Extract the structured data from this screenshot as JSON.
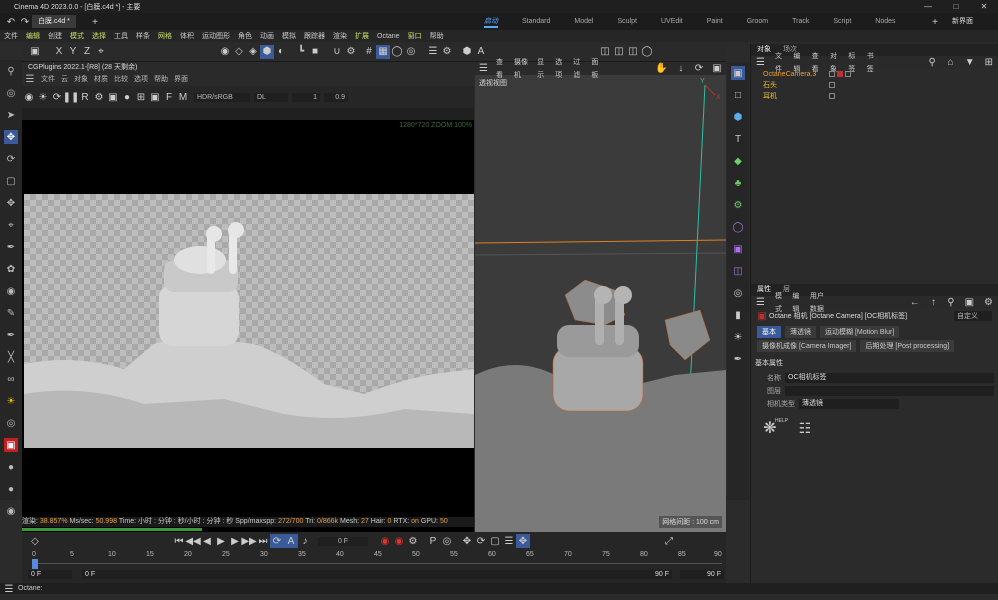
{
  "titlebar": {
    "title": "Cinema 4D 2023.0.0 - [白膜.c4d *] - 主要"
  },
  "tabs": {
    "doc": "白膜.c4d *",
    "layouts": [
      "启动",
      "Standard",
      "Model",
      "Sculpt",
      "UVEdit",
      "Paint",
      "Groom",
      "Track",
      "Script",
      "Nodes"
    ],
    "new_layout": "新界面"
  },
  "menu": [
    "文件",
    "编辑",
    "创建",
    "模式",
    "选择",
    "工具",
    "样条",
    "网格",
    "体积",
    "运动图形",
    "角色",
    "动画",
    "模拟",
    "跟踪器",
    "渲染",
    "扩展",
    "Octane",
    "窗口",
    "帮助"
  ],
  "axis": {
    "x": "X",
    "y": "Y",
    "z": "Z"
  },
  "render_view": {
    "title": "CGPlugins   2022.1-[R8] (28 天剩余)",
    "menu": [
      "文件",
      "云",
      "对象",
      "材质",
      "比较",
      "选项",
      "帮助",
      "界面"
    ],
    "colorspace": "HDR/sRGB",
    "mode": "DL",
    "value1": "1",
    "value2": "0.9",
    "zoom_overlay": "1280*720 ZOOM:100%",
    "stats": {
      "p1": "渲染:",
      "p2": "38.857%",
      "p3": "Ms/sec:",
      "p4": "50.998",
      "p5": "Time: 小时 : 分钟 : 秒/小时 : 分钟 : 秒",
      "p6": "Spp/maxspp:",
      "p7": "272/700",
      "p8": "Tri:",
      "p9": "0/866k",
      "p10": "Mesh:",
      "p11": "27",
      "p12": "Hair:",
      "p13": "0",
      "p14": "RTX:",
      "p15": "on",
      "p16": "GPU:",
      "p17": "50"
    }
  },
  "viewport": {
    "menu": [
      "查看",
      "摄像机",
      "显示",
      "选项",
      "过滤",
      "面板"
    ],
    "label": "透视视图",
    "grid_scale": "网格间距 : 100 cm",
    "axis_y": "Y",
    "axis_x": "X"
  },
  "objects": {
    "tabs": [
      "对象",
      "场次"
    ],
    "menu": [
      "文件",
      "编辑",
      "查看",
      "对象",
      "标签",
      "书签"
    ],
    "items": [
      "OctaneCamera.3",
      "石头",
      "耳机"
    ]
  },
  "attributes": {
    "tabs": [
      "属性",
      "层"
    ],
    "menu": [
      "模式",
      "编辑",
      "用户数据"
    ],
    "title": "Octane 相机 [Octane Camera] [OC相机标签]",
    "preset": "自定义",
    "buttons": [
      "基本",
      "薄透镜",
      "运动模糊 [Motion Blur]",
      "摄像机成像 [Camera Imager]",
      "后期处理 [Post processing]"
    ],
    "section": "基本属性",
    "name_label": "名称",
    "name_value": "OC相机标签",
    "layer_label": "图层",
    "camtype_label": "相机类型",
    "camtype_value": "薄透镜",
    "help": "HELP"
  },
  "timeline": {
    "current": "0 F",
    "ticks": [
      "0",
      "5",
      "10",
      "15",
      "20",
      "25",
      "30",
      "35",
      "40",
      "45",
      "50",
      "55",
      "60",
      "65",
      "70",
      "75",
      "80",
      "85",
      "90"
    ],
    "start": "0 F",
    "start2": "0 F",
    "end": "90 F",
    "end2": "90 F"
  },
  "status": {
    "text": "Octane:"
  }
}
